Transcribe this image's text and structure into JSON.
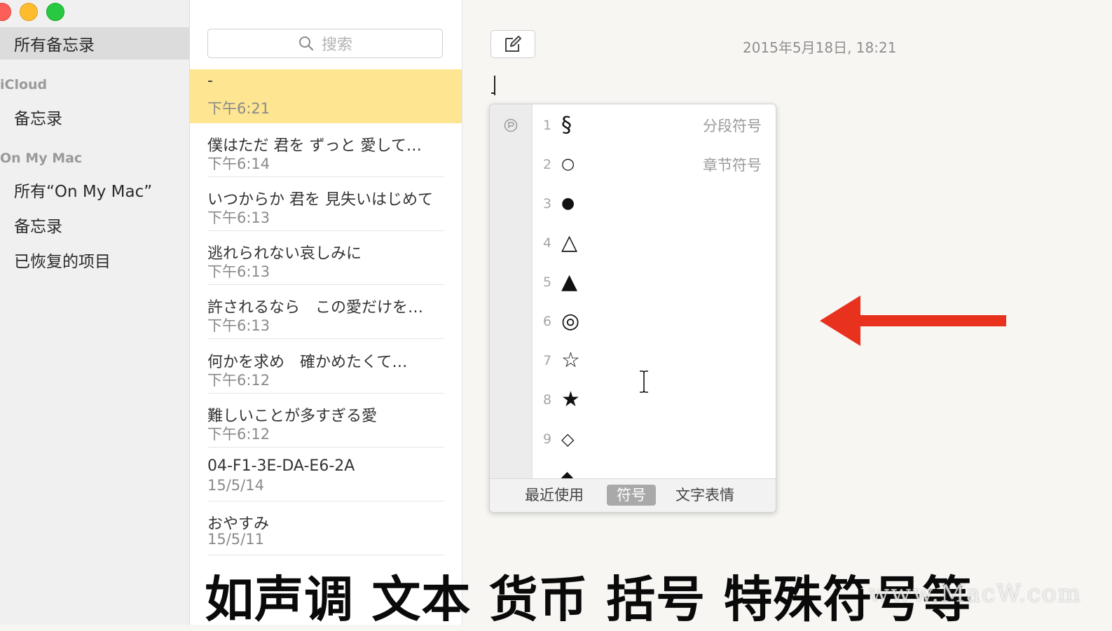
{
  "sidebar": {
    "all_notes": "所有备忘录",
    "icloud_header": "iCloud",
    "icloud_notes": "备忘录",
    "on_my_mac_header": "On My Mac",
    "all_on_my_mac": "所有“On My Mac”",
    "on_my_mac_notes": "备忘录",
    "recovered": "已恢复的项目"
  },
  "search": {
    "placeholder": "搜索"
  },
  "notes": [
    {
      "title": "-",
      "date": "下午6:21"
    },
    {
      "title": "僕はただ 君を ずっと 愛して…",
      "date": "下午6:14"
    },
    {
      "title": "いつからか 君を 見失いはじめて",
      "date": "下午6:13"
    },
    {
      "title": "逃れられない哀しみに",
      "date": "下午6:13"
    },
    {
      "title": "許されるなら　この愛だけを…",
      "date": "下午6:13"
    },
    {
      "title": "何かを求め　確かめたくて…",
      "date": "下午6:12"
    },
    {
      "title": "難しいことが多すぎる愛",
      "date": "下午6:12"
    },
    {
      "title": "04-F1-3E-DA-E6-2A",
      "date": "15/5/14"
    },
    {
      "title": "おやすみ",
      "date": "15/5/11"
    }
  ],
  "editor": {
    "date": "2015年5月18日, 18:21"
  },
  "symbols": [
    {
      "num": "1",
      "glyph": "§",
      "name": "分段符号"
    },
    {
      "num": "2",
      "glyph": "○",
      "name": "章节符号"
    },
    {
      "num": "3",
      "glyph": "●",
      "name": ""
    },
    {
      "num": "4",
      "glyph": "△",
      "name": ""
    },
    {
      "num": "5",
      "glyph": "▲",
      "name": ""
    },
    {
      "num": "6",
      "glyph": "◎",
      "name": ""
    },
    {
      "num": "7",
      "glyph": "☆",
      "name": ""
    },
    {
      "num": "8",
      "glyph": "★",
      "name": ""
    },
    {
      "num": "9",
      "glyph": "◇",
      "name": ""
    },
    {
      "num": "",
      "glyph": "◆",
      "name": ""
    }
  ],
  "popover_tabs": {
    "recent": "最近使用",
    "symbols": "符号",
    "emoticons": "文字表情"
  },
  "subtitle": "如声调 文本 货币 括号 特殊符号等",
  "watermark": "www.MacW.com",
  "colors": {
    "selected_note": "#fde591",
    "arrow": "#e8321e",
    "active_tab": "#a9a9a9"
  }
}
